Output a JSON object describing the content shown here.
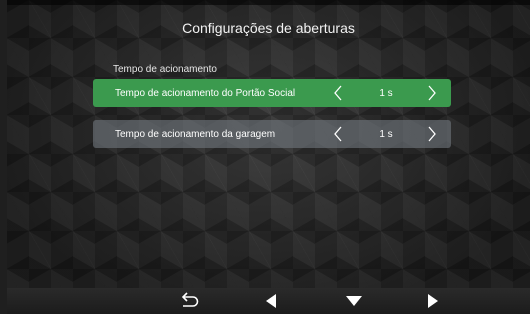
{
  "title": "Configurações de aberturas",
  "section": {
    "label": "Tempo de acionamento"
  },
  "rows": [
    {
      "label": "Tempo de acionamento do Portão Social",
      "value": "1 s",
      "selected": true
    },
    {
      "label": "Tempo de acionamento da garagem",
      "value": "1 s",
      "selected": false
    }
  ],
  "icons": {
    "prev": "chevron-left-icon",
    "next": "chevron-right-icon",
    "back": "return-arrow-icon",
    "left": "triangle-left-icon",
    "down": "triangle-down-icon",
    "right": "triangle-right-icon"
  },
  "colors": {
    "selected_row": "#3b9a4e",
    "normal_row": "#70767c"
  }
}
